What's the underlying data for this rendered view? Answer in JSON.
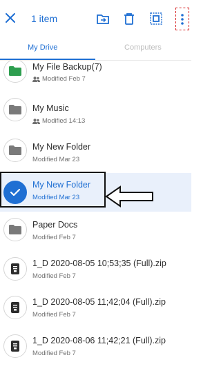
{
  "header": {
    "selection_count": "1 item",
    "icons": [
      "close-icon",
      "move-to-folder-icon",
      "trash-icon",
      "select-all-icon",
      "more-vert-icon"
    ]
  },
  "tabs": [
    {
      "label": "My Drive",
      "active": true
    },
    {
      "label": "Computers",
      "active": false
    }
  ],
  "files": [
    {
      "name": "My File Backup(7)",
      "modified": "Modified Feb 7",
      "type": "folder-shared-green",
      "shared": true,
      "selected": false
    },
    {
      "name": "My Music",
      "modified": "Modified 14:13",
      "type": "folder",
      "shared": true,
      "selected": false
    },
    {
      "name": "My New Folder",
      "modified": "Modified Mar 23",
      "type": "folder",
      "shared": false,
      "selected": false
    },
    {
      "name": "My New Folder",
      "modified": "Modified Mar 23",
      "type": "folder",
      "shared": false,
      "selected": true
    },
    {
      "name": "Paper Docs",
      "modified": "Modified Feb 7",
      "type": "folder",
      "shared": false,
      "selected": false
    },
    {
      "name": "1_D 2020-08-05 10;53;35 (Full).zip",
      "modified": "Modified Feb 7",
      "type": "zip",
      "shared": false,
      "selected": false
    },
    {
      "name": "1_D 2020-08-05 11;42;04 (Full).zip",
      "modified": "Modified Feb 7",
      "type": "zip",
      "shared": false,
      "selected": false
    },
    {
      "name": "1_D 2020-08-06 11;42;21 (Full).zip",
      "modified": "Modified Feb 7",
      "type": "zip",
      "shared": false,
      "selected": false
    }
  ],
  "colors": {
    "accent": "#1f6fd3",
    "folder_gray": "#7a7a7a",
    "folder_green": "#2e9e4f",
    "selected_bg": "#e9f0fb",
    "annotation": "#111111",
    "more_box": "#d61f1f"
  }
}
